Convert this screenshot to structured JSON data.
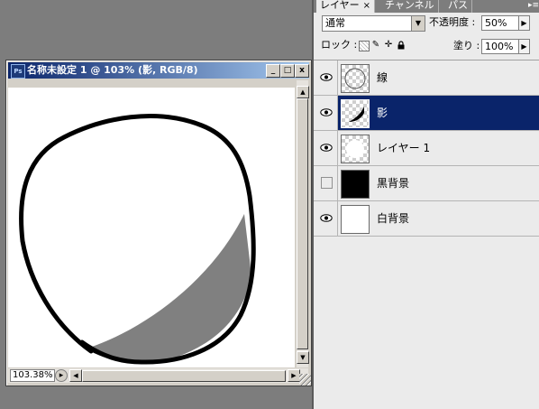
{
  "document": {
    "title": "名称未設定 1 @ 103% (影, RGB/8)",
    "app_icon": "Ps",
    "zoom": "103.38%",
    "controls": {
      "minimize": "_",
      "maximize": "□",
      "close": "x"
    }
  },
  "panel": {
    "tabs": [
      {
        "label": "レイヤー",
        "active": true,
        "close": "×"
      },
      {
        "label": "チャンネル",
        "active": false
      },
      {
        "label": "パス",
        "active": false
      }
    ],
    "menu_icon": "▸≡",
    "blend_mode": "通常",
    "opacity_label": "不透明度 :",
    "opacity": "50%",
    "lock_label": "ロック :",
    "fill_label": "塗り :",
    "fill": "100%",
    "lock_icons": [
      "lock-transparency-icon",
      "lock-pixels-icon",
      "lock-position-icon",
      "lock-all-icon"
    ]
  },
  "layers": [
    {
      "name": "線",
      "visible": true,
      "selected": false,
      "thumb": "line-art"
    },
    {
      "name": "影",
      "visible": true,
      "selected": true,
      "thumb": "shadow"
    },
    {
      "name": "レイヤー 1",
      "visible": true,
      "selected": false,
      "thumb": "transparent"
    },
    {
      "name": "黒背景",
      "visible": false,
      "selected": false,
      "thumb": "black"
    },
    {
      "name": "白背景",
      "visible": true,
      "selected": false,
      "thumb": "white"
    }
  ],
  "colors": {
    "selection": "#0a246a",
    "shadow_fill": "#808080",
    "workspace": "#7d7d7d"
  }
}
